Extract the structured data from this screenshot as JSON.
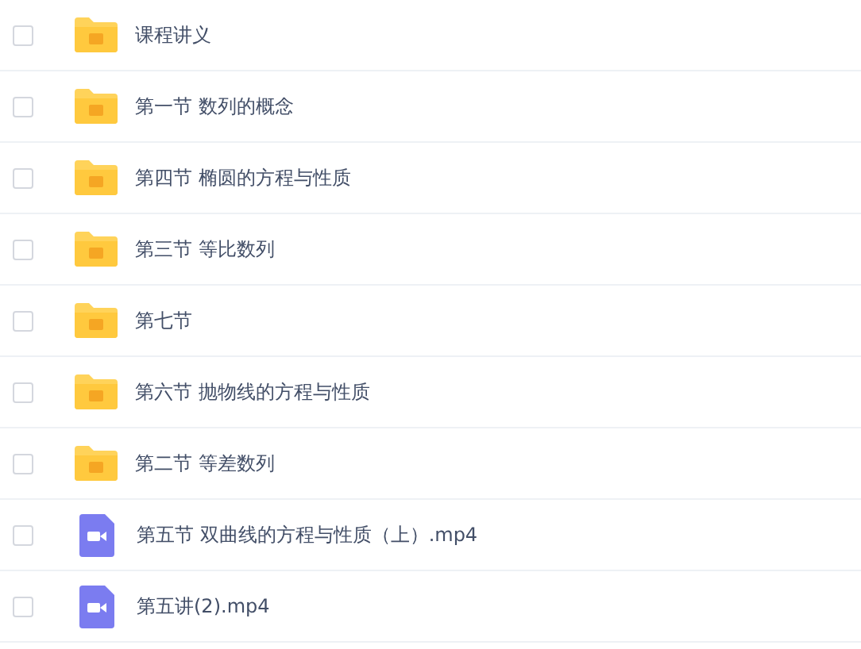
{
  "files": [
    {
      "kind": "folder",
      "name": "课程讲义",
      "checked": false
    },
    {
      "kind": "folder",
      "name": "第一节 数列的概念",
      "checked": false
    },
    {
      "kind": "folder",
      "name": "第四节 椭圆的方程与性质",
      "checked": false
    },
    {
      "kind": "folder",
      "name": "第三节 等比数列",
      "checked": false
    },
    {
      "kind": "folder",
      "name": "第七节",
      "checked": false
    },
    {
      "kind": "folder",
      "name": "第六节 抛物线的方程与性质",
      "checked": false
    },
    {
      "kind": "folder",
      "name": "第二节 等差数列",
      "checked": false
    },
    {
      "kind": "video",
      "name": "第五节 双曲线的方程与性质（上）.mp4",
      "checked": false
    },
    {
      "kind": "video",
      "name": "第五讲(2).mp4",
      "checked": false
    }
  ]
}
